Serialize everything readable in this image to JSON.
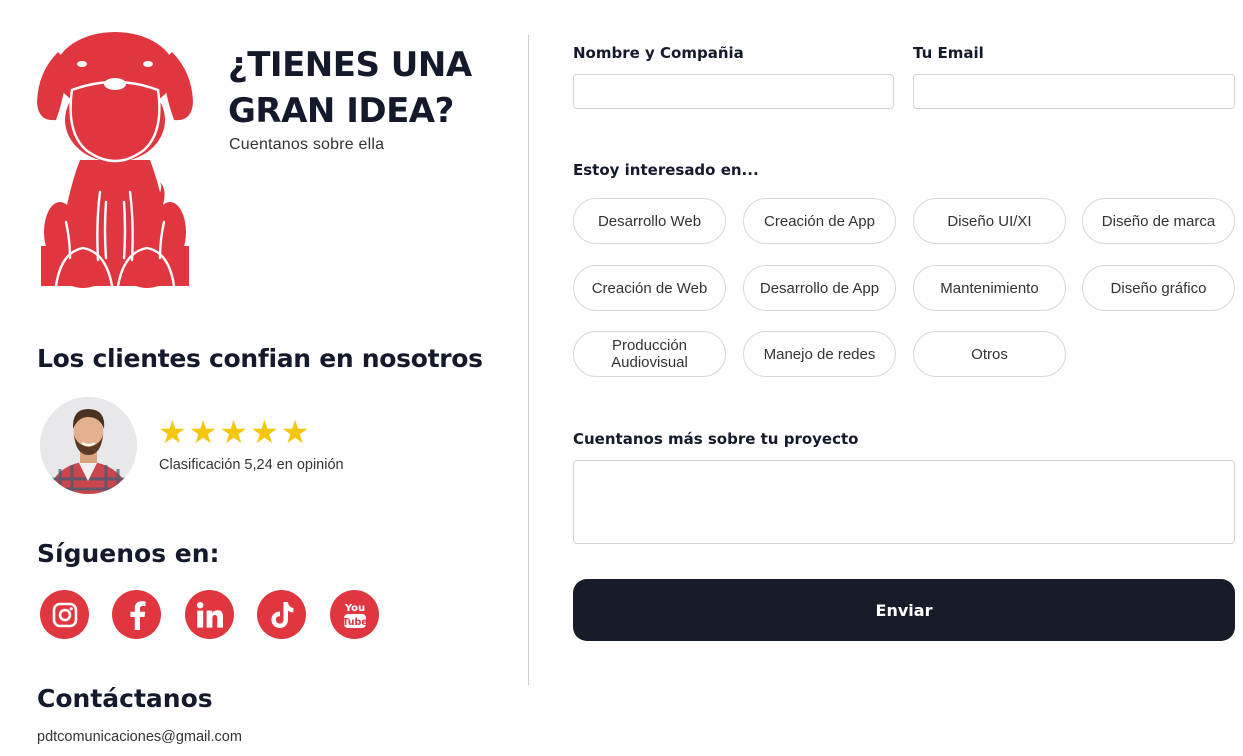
{
  "hero": {
    "headline": "¿TIENES UNA\nGRAN IDEA?",
    "subline": "Cuentanos sobre ella"
  },
  "brand": {
    "logo_icon": "dog-logo-icon",
    "accent_color": "#df3640",
    "dark_color": "#161c29",
    "star_color": "#f5c70a"
  },
  "trust": {
    "title": "Los clientes confian en nosotros",
    "stars": "★★★★★",
    "rating_value": 5,
    "rating_text": "Clasificación 5,24 en opinión"
  },
  "social": {
    "title": "Síguenos en:",
    "items": [
      {
        "name": "instagram",
        "icon": "instagram-icon"
      },
      {
        "name": "facebook",
        "icon": "facebook-icon"
      },
      {
        "name": "linkedin",
        "icon": "linkedin-icon"
      },
      {
        "name": "tiktok",
        "icon": "tiktok-icon"
      },
      {
        "name": "youtube",
        "icon": "youtube-icon"
      }
    ]
  },
  "contact": {
    "title": "Contáctanos",
    "email": "pdtcomunicaciones@gmail.com"
  },
  "form": {
    "name_label": "Nombre y Compañia",
    "name_value": "",
    "email_label": "Tu Email",
    "email_value": "",
    "interest_label": "Estoy interesado en...",
    "interests": [
      "Desarrollo Web",
      "Creación de App",
      "Diseño UI/XI",
      "Diseño de marca",
      "Creación de Web",
      "Desarrollo de App",
      "Mantenimiento",
      "Diseño gráfico",
      "Producción\nAudiovisual",
      "Manejo de redes",
      "Otros"
    ],
    "project_label": "Cuentanos más sobre tu proyecto",
    "project_value": "",
    "submit_label": "Enviar"
  }
}
